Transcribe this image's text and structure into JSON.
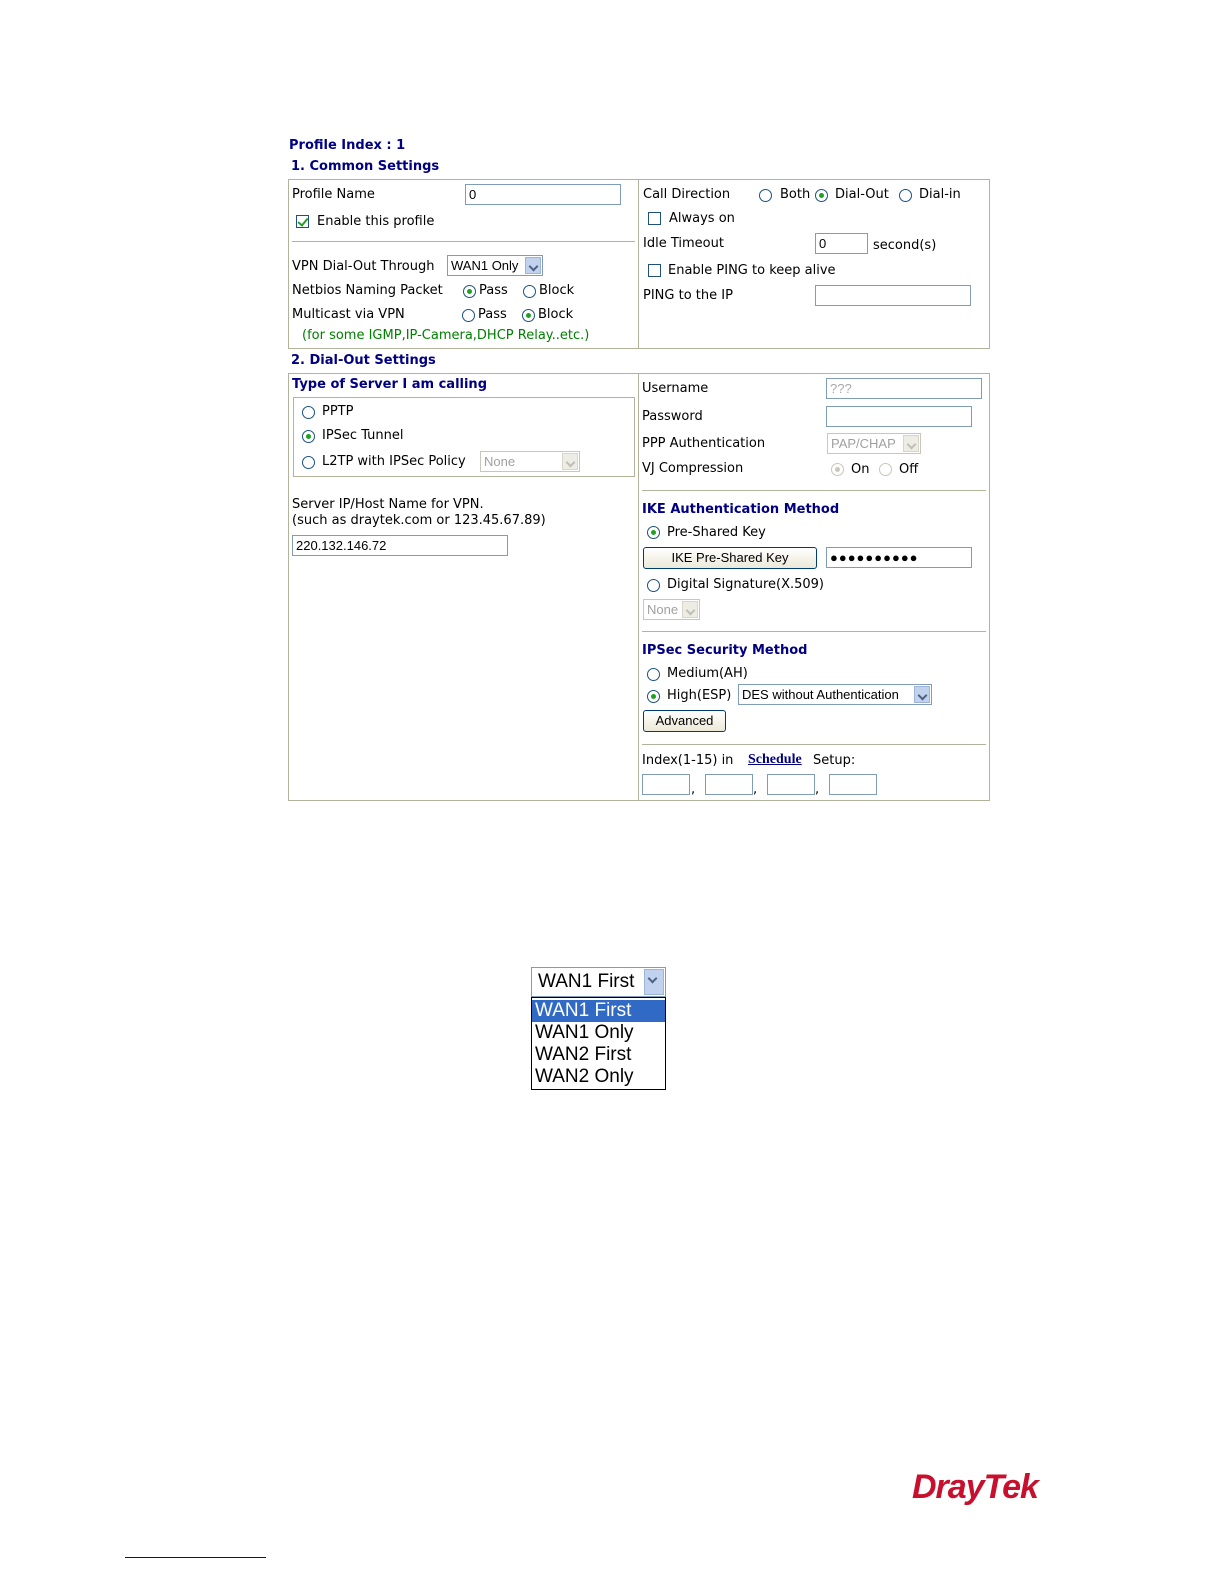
{
  "profile_index": "Profile Index : 1",
  "common": {
    "section_title": "1. Common Settings",
    "profile_name_label": "Profile Name",
    "profile_name_value": "0",
    "enable_label": "Enable this profile",
    "call_direction_label": "Call Direction",
    "dir_both": "Both",
    "dir_dialout": "Dial-Out",
    "dir_dialin": "Dial-in",
    "always_on": "Always on",
    "idle_timeout_label": "Idle Timeout",
    "idle_timeout_value": "0",
    "idle_timeout_unit": "second(s)",
    "ping_keepalive": "Enable PING to keep alive",
    "ping_ip_label": "PING to the IP",
    "vpn_dialout_label": "VPN Dial-Out Through",
    "vpn_dialout_value": "WAN1 Only",
    "netbios_label": "Netbios Naming Packet",
    "multicast_label": "Multicast via VPN",
    "pass": "Pass",
    "block": "Block",
    "multicast_note": "(for some IGMP,IP-Camera,DHCP Relay..etc.)"
  },
  "dialout": {
    "section_title": "2. Dial-Out Settings",
    "server_type_title": "Type of Server I am calling",
    "pptp": "PPTP",
    "ipsec_tunnel": "IPSec Tunnel",
    "l2tp": "L2TP with IPSec Policy",
    "l2tp_policy": "None",
    "server_host_label1": "Server IP/Host Name for VPN.",
    "server_host_label2": "(such as draytek.com or 123.45.67.89)",
    "server_host_value": "220.132.146.72",
    "username_label": "Username",
    "username_placeholder": "???",
    "password_label": "Password",
    "ppp_auth_label": "PPP Authentication",
    "ppp_auth_value": "PAP/CHAP",
    "vj_label": "VJ Compression",
    "vj_on": "On",
    "vj_off": "Off",
    "ike_title": "IKE Authentication Method",
    "preshared": "Pre-Shared Key",
    "ike_button": "IKE Pre-Shared Key",
    "ike_key_value": "●●●●●●●●●●",
    "digital_sig": "Digital Signature(X.509)",
    "digital_sig_value": "None",
    "ipsec_title": "IPSec Security Method",
    "medium": "Medium(AH)",
    "high": "High(ESP)",
    "high_value": "DES without Authentication",
    "advanced": "Advanced",
    "schedule_prefix": "Index(1-15) in",
    "schedule_link": "Schedule",
    "schedule_suffix": "Setup:"
  },
  "dropdown": {
    "selected": "WAN1 First",
    "options": [
      "WAN1 First",
      "WAN1 Only",
      "WAN2 First",
      "WAN2 Only"
    ]
  },
  "logo": {
    "text": "DrayTek",
    "color": "#c8102e"
  }
}
